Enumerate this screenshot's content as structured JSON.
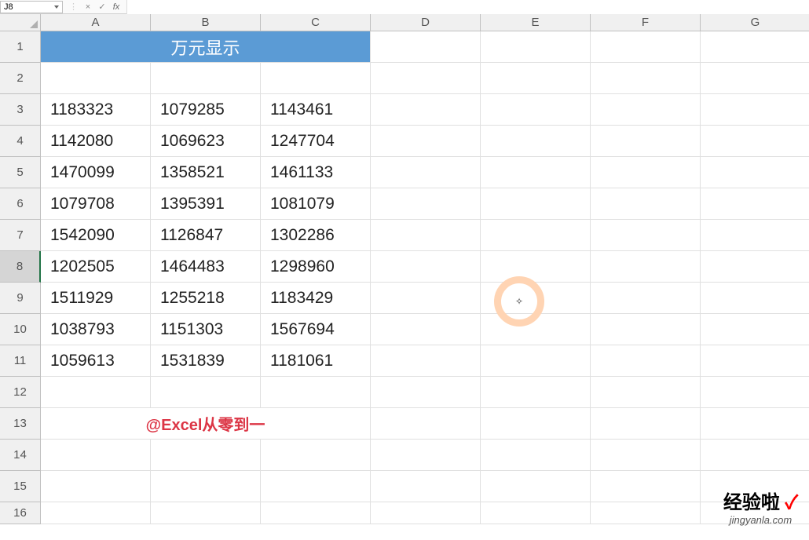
{
  "name_box": "J8",
  "formula": "",
  "columns": [
    "A",
    "B",
    "C",
    "D",
    "E",
    "F",
    "G"
  ],
  "row_numbers": [
    1,
    2,
    3,
    4,
    5,
    6,
    7,
    8,
    9,
    10,
    11,
    12,
    13,
    14,
    15,
    16
  ],
  "merged_title": "万元显示",
  "selected_row": 8,
  "chart_data": {
    "type": "table",
    "title": "万元显示",
    "columns": [
      "A",
      "B",
      "C"
    ],
    "rows": [
      [
        1183323,
        1079285,
        1143461
      ],
      [
        1142080,
        1069623,
        1247704
      ],
      [
        1470099,
        1358521,
        1461133
      ],
      [
        1079708,
        1395391,
        1081079
      ],
      [
        1542090,
        1126847,
        1302286
      ],
      [
        1202505,
        1464483,
        1298960
      ],
      [
        1511929,
        1255218,
        1183429
      ],
      [
        1038793,
        1151303,
        1567694
      ],
      [
        1059613,
        1531839,
        1181061
      ]
    ]
  },
  "annotation": "@Excel从零到一",
  "watermark": {
    "main": "经验啦",
    "sub": "jingyanla.com"
  }
}
